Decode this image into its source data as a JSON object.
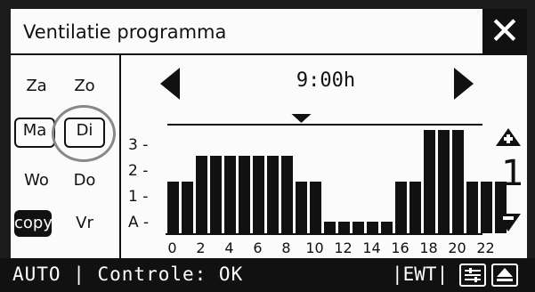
{
  "title": "Ventilatie programma",
  "close_symbol": "✕",
  "days": {
    "za": "Za",
    "zo": "Zo",
    "ma": "Ma",
    "di": "Di",
    "wo": "Wo",
    "do": "Do",
    "copy": "copy",
    "vr": "Vr"
  },
  "time": "9:00h",
  "level_value": "1",
  "y_axis": [
    "3 -",
    "2 -",
    "1 -",
    "A -"
  ],
  "x_ticks": [
    "0",
    "2",
    "4",
    "6",
    "8",
    "10",
    "12",
    "14",
    "16",
    "18",
    "20",
    "22"
  ],
  "status": {
    "text": "AUTO | Controle: OK",
    "ewt": "|EWT|"
  },
  "chart_data": {
    "type": "bar",
    "x": [
      0,
      1,
      2,
      3,
      4,
      5,
      6,
      7,
      8,
      9,
      10,
      11,
      12,
      13,
      14,
      15,
      16,
      17,
      18,
      19,
      20,
      21,
      22,
      23
    ],
    "values": [
      1,
      1,
      2,
      2,
      2,
      2,
      2,
      2,
      2,
      1,
      1,
      0,
      0,
      0,
      0,
      0,
      1,
      1,
      3,
      3,
      3,
      1,
      1,
      1
    ],
    "y_levels": [
      "A",
      "1",
      "2",
      "3"
    ],
    "ylim": [
      0,
      3
    ]
  }
}
